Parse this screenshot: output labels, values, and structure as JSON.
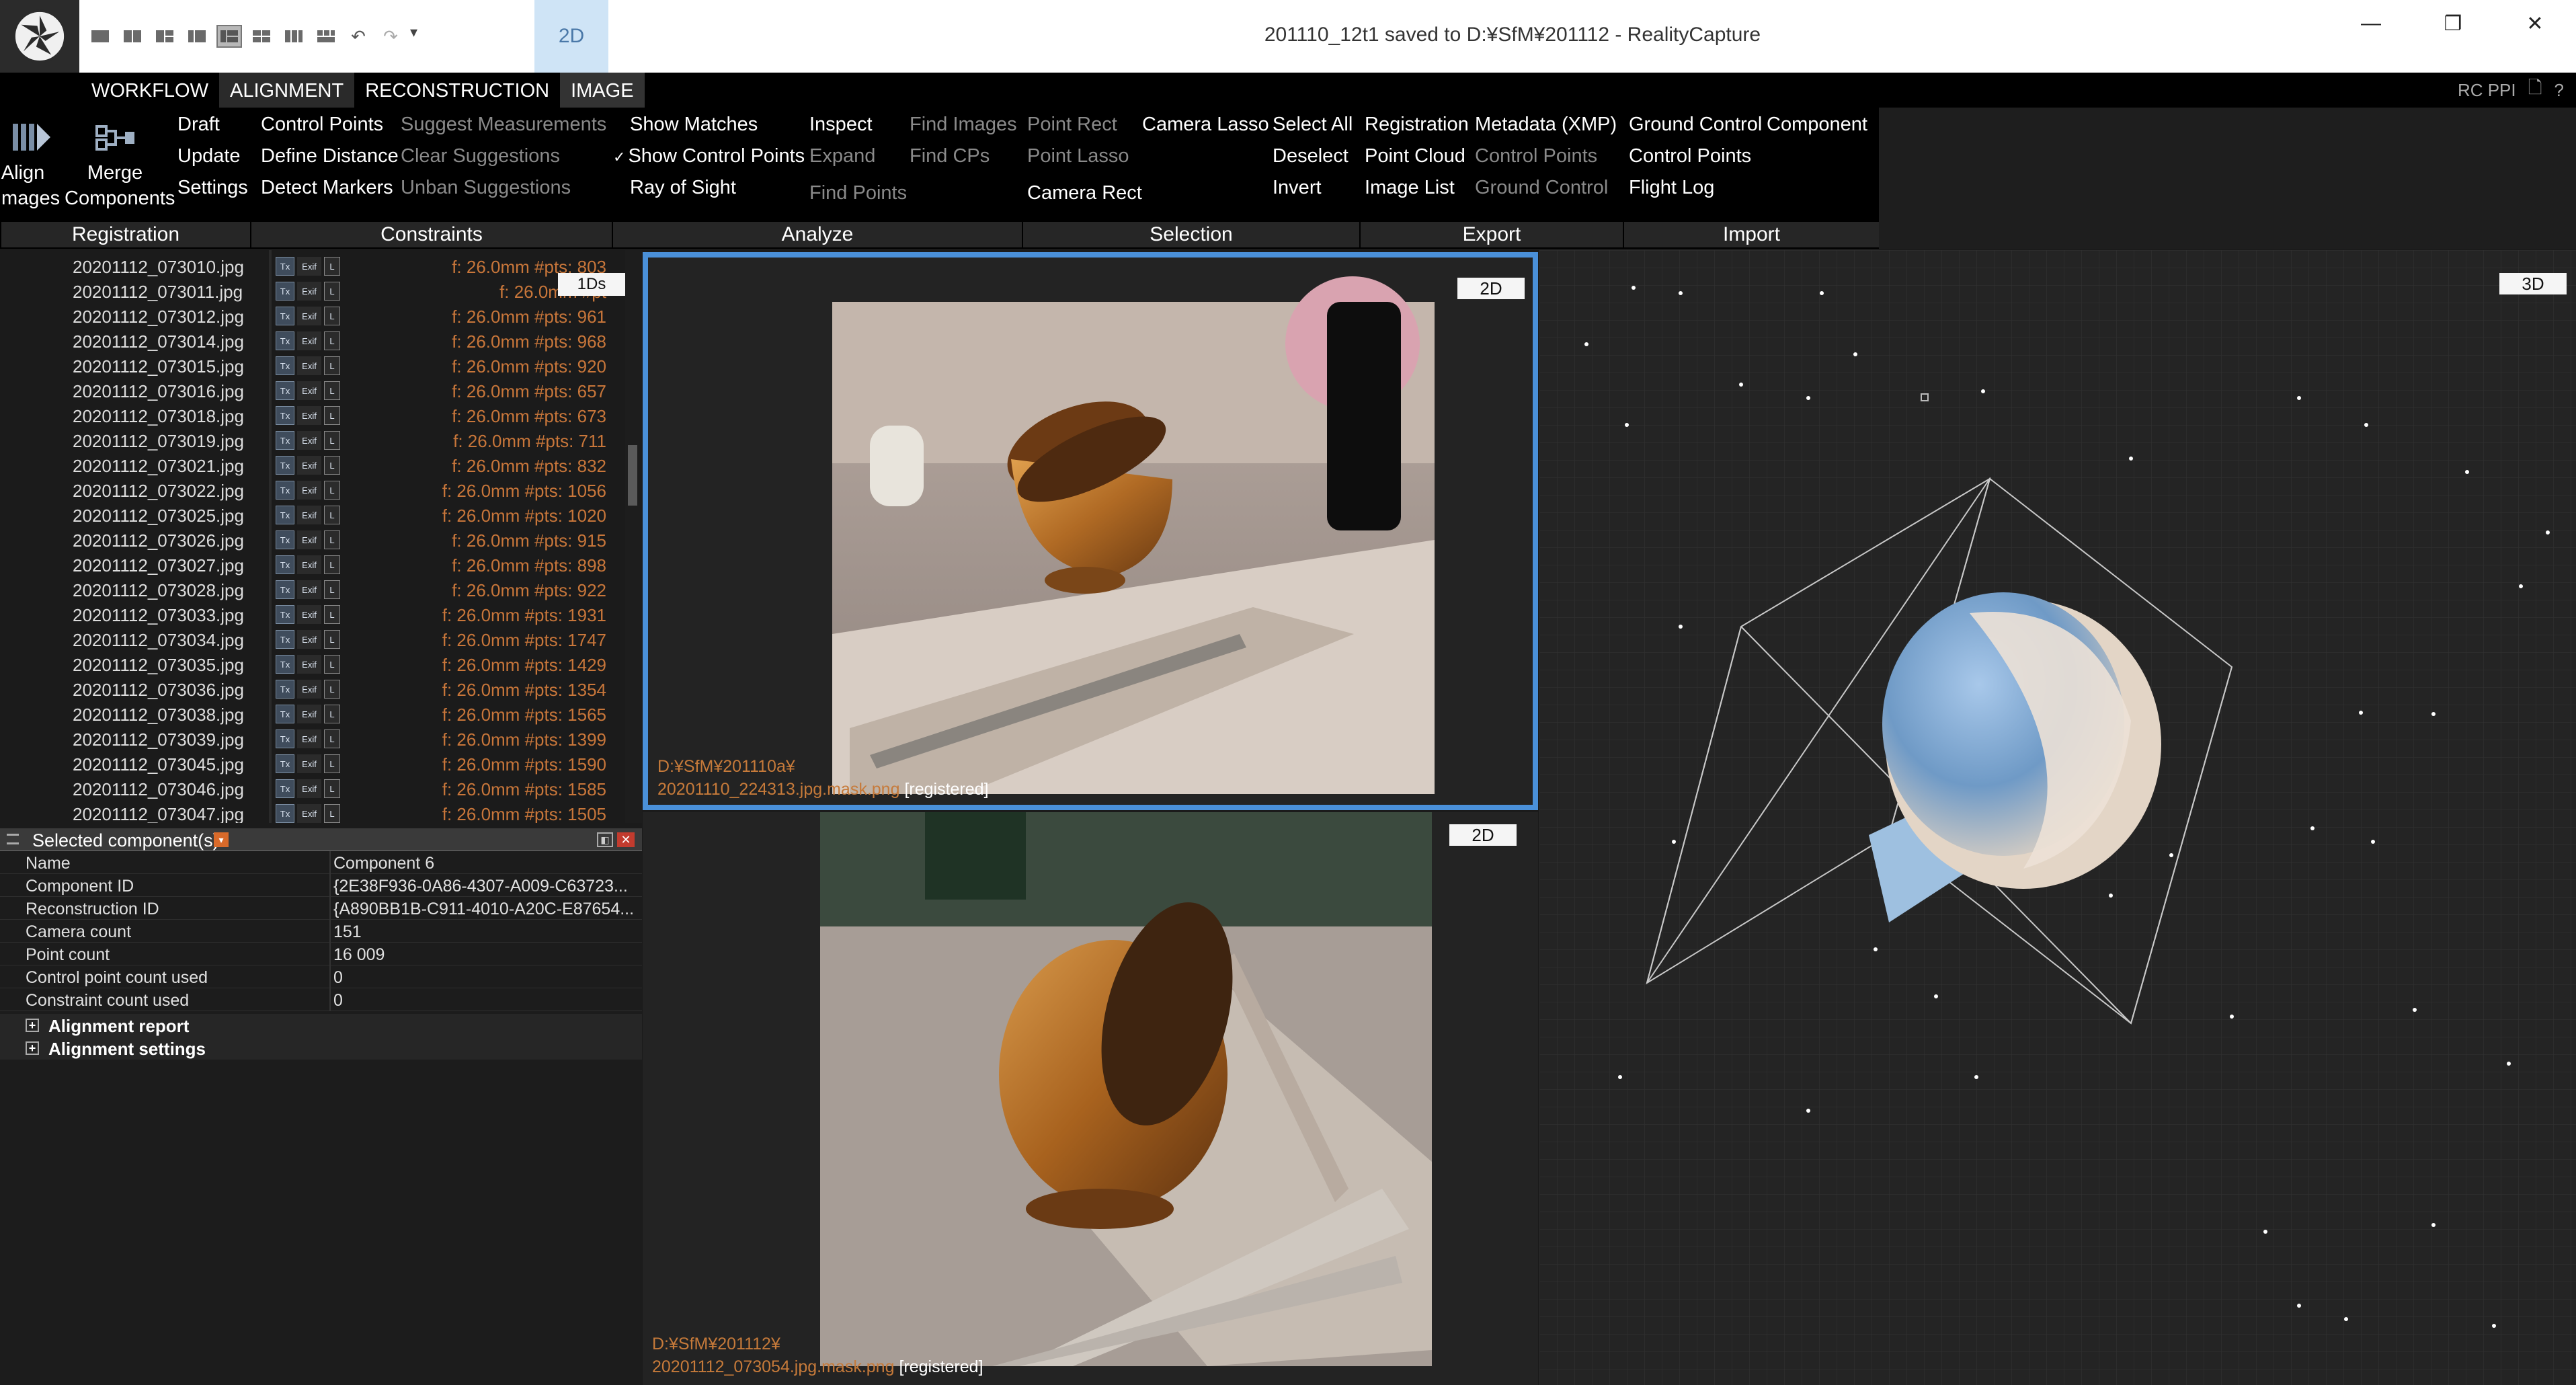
{
  "titlebar": {
    "title": "201110_12t1 saved to D:¥SfM¥201112 - RealityCapture",
    "view_tab": "2D",
    "minimize": "—",
    "restore": "❐",
    "close": "✕"
  },
  "menu": {
    "tabs": [
      "WORKFLOW",
      "ALIGNMENT",
      "RECONSTRUCTION",
      "IMAGE"
    ],
    "active_tab": "ALIGNMENT",
    "right_label": "RC PPI"
  },
  "ribbon": {
    "align_images": "Align Images",
    "merge_components": "Merge Components",
    "draft": "Draft",
    "update": "Update",
    "settings": "Settings",
    "control_points": "Control Points",
    "define_distance": "Define Distance",
    "detect_markers": "Detect Markers",
    "suggest_measurements": "Suggest Measurements",
    "clear_suggestions": "Clear Suggestions",
    "unban_suggestions": "Unban Suggestions",
    "show_matches": "Show Matches",
    "show_control_points": "Show Control Points",
    "ray_of_sight": "Ray of Sight",
    "inspect": "Inspect",
    "expand": "Expand",
    "find_points": "Find Points",
    "find_images": "Find Images",
    "find_cps": "Find CPs",
    "point_rect": "Point Rect",
    "point_lasso": "Point Lasso",
    "camera_rect": "Camera Rect",
    "camera_lasso": "Camera Lasso",
    "select_all": "Select All",
    "deselect": "Deselect",
    "invert": "Invert",
    "registration": "Registration",
    "point_cloud": "Point Cloud",
    "image_list": "Image List",
    "metadata_xmp": "Metadata (XMP)",
    "export_control_points": "Control Points",
    "ground_control": "Ground Control",
    "import_ground_control": "Ground Control",
    "component": "Component",
    "import_control_points": "Control Points",
    "flight_log": "Flight Log",
    "groups": [
      "Registration",
      "Constraints",
      "Analyze",
      "Selection",
      "Export",
      "Import"
    ]
  },
  "image_list": {
    "mode_button": "1Ds",
    "rows": [
      {
        "file": "20201112_073010.jpg",
        "info": "f: 26.0mm #pts: 803"
      },
      {
        "file": "20201112_073011.jpg",
        "info": "f: 26.0mm #pt"
      },
      {
        "file": "20201112_073012.jpg",
        "info": "f: 26.0mm #pts: 961"
      },
      {
        "file": "20201112_073014.jpg",
        "info": "f: 26.0mm #pts: 968"
      },
      {
        "file": "20201112_073015.jpg",
        "info": "f: 26.0mm #pts: 920"
      },
      {
        "file": "20201112_073016.jpg",
        "info": "f: 26.0mm #pts: 657"
      },
      {
        "file": "20201112_073018.jpg",
        "info": "f: 26.0mm #pts: 673"
      },
      {
        "file": "20201112_073019.jpg",
        "info": "f: 26.0mm #pts: 711"
      },
      {
        "file": "20201112_073021.jpg",
        "info": "f: 26.0mm #pts: 832"
      },
      {
        "file": "20201112_073022.jpg",
        "info": "f: 26.0mm #pts: 1056"
      },
      {
        "file": "20201112_073025.jpg",
        "info": "f: 26.0mm #pts: 1020"
      },
      {
        "file": "20201112_073026.jpg",
        "info": "f: 26.0mm #pts: 915"
      },
      {
        "file": "20201112_073027.jpg",
        "info": "f: 26.0mm #pts: 898"
      },
      {
        "file": "20201112_073028.jpg",
        "info": "f: 26.0mm #pts: 922"
      },
      {
        "file": "20201112_073033.jpg",
        "info": "f: 26.0mm #pts: 1931"
      },
      {
        "file": "20201112_073034.jpg",
        "info": "f: 26.0mm #pts: 1747"
      },
      {
        "file": "20201112_073035.jpg",
        "info": "f: 26.0mm #pts: 1429"
      },
      {
        "file": "20201112_073036.jpg",
        "info": "f: 26.0mm #pts: 1354"
      },
      {
        "file": "20201112_073038.jpg",
        "info": "f: 26.0mm #pts: 1565"
      },
      {
        "file": "20201112_073039.jpg",
        "info": "f: 26.0mm #pts: 1399"
      },
      {
        "file": "20201112_073045.jpg",
        "info": "f: 26.0mm #pts: 1590"
      },
      {
        "file": "20201112_073046.jpg",
        "info": "f: 26.0mm #pts: 1585"
      },
      {
        "file": "20201112_073047.jpg",
        "info": "f: 26.0mm #pts: 1505"
      }
    ]
  },
  "properties": {
    "title": "Selected component(s)",
    "rows": [
      {
        "key": "Name",
        "value": "Component 6"
      },
      {
        "key": "Component ID",
        "value": "{2E38F936-0A86-4307-A009-C63723..."
      },
      {
        "key": "Reconstruction ID",
        "value": "{A890BB1B-C911-4010-A20C-E87654..."
      },
      {
        "key": "Camera count",
        "value": "151"
      },
      {
        "key": "Point count",
        "value": "16 009"
      },
      {
        "key": "Control point count used",
        "value": "0"
      },
      {
        "key": "Constraint count used",
        "value": "0"
      }
    ],
    "sections": [
      "Alignment report",
      "Alignment settings"
    ]
  },
  "viewport_top": {
    "label": "2D",
    "path_line1": "D:¥SfM¥201110a¥",
    "path_line2": "20201110_224313.jpg.mask.png",
    "status": "[registered]"
  },
  "viewport_bottom": {
    "label": "2D",
    "path_line1": "D:¥SfM¥201112¥",
    "path_line2": "20201112_073054.jpg.mask.png",
    "status": "[registered]"
  },
  "viewport_3d": {
    "label": "3D"
  },
  "colors": {
    "accent": "#4a90d9",
    "orange_text": "#c8763a",
    "ribbon_bg": "#000000"
  }
}
